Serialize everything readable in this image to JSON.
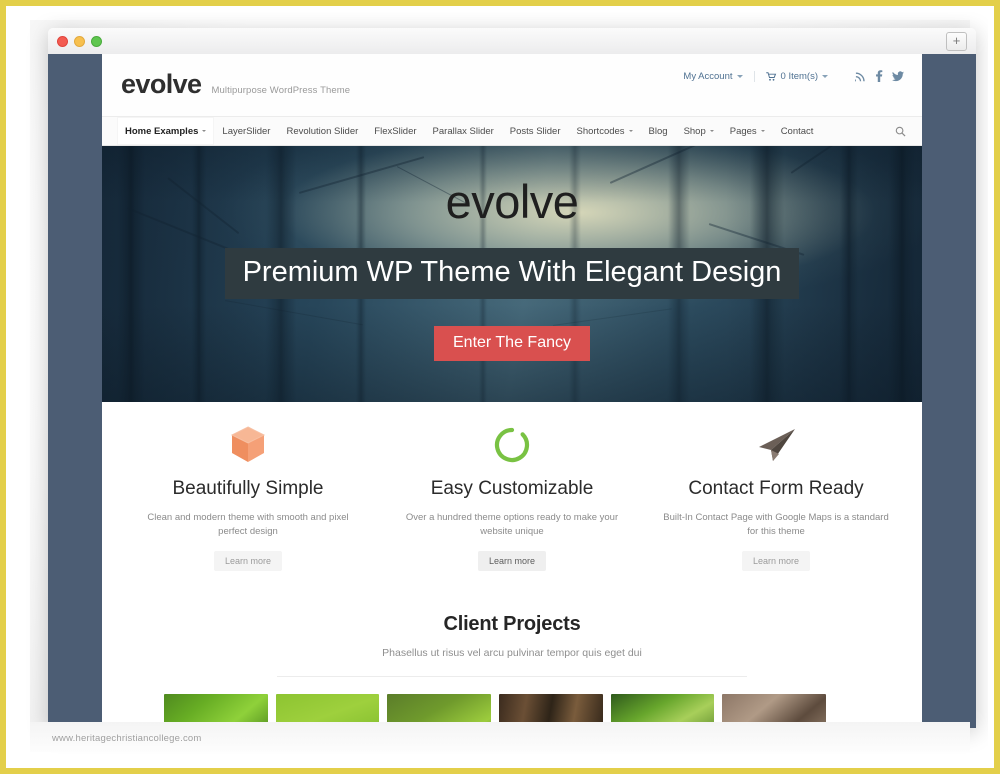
{
  "browser": {
    "traffic_lights": [
      "close",
      "minimize",
      "zoom"
    ],
    "new_tab_label": "+"
  },
  "site": {
    "logo": "evolve",
    "tagline": "Multipurpose WordPress Theme",
    "topbar": {
      "account_label": "My Account",
      "cart_label": "0 Item(s)",
      "social": [
        "rss-icon",
        "facebook-icon",
        "twitter-icon"
      ]
    },
    "nav": [
      {
        "label": "Home Examples",
        "caret": true,
        "active": true
      },
      {
        "label": "LayerSlider",
        "caret": false,
        "active": false
      },
      {
        "label": "Revolution Slider",
        "caret": false,
        "active": false
      },
      {
        "label": "FlexSlider",
        "caret": false,
        "active": false
      },
      {
        "label": "Parallax Slider",
        "caret": false,
        "active": false
      },
      {
        "label": "Posts Slider",
        "caret": false,
        "active": false
      },
      {
        "label": "Shortcodes",
        "caret": true,
        "active": false
      },
      {
        "label": "Blog",
        "caret": false,
        "active": false
      },
      {
        "label": "Shop",
        "caret": true,
        "active": false
      },
      {
        "label": "Pages",
        "caret": true,
        "active": false
      },
      {
        "label": "Contact",
        "caret": false,
        "active": false
      }
    ],
    "hero": {
      "title": "evolve",
      "band": "Premium WP Theme With Elegant Design",
      "cta": "Enter The Fancy",
      "cta_color": "#d9504f",
      "band_color": "#2f3b40"
    },
    "features": [
      {
        "icon": "cube-icon",
        "icon_color": "#f0936a",
        "title": "Beautifully Simple",
        "desc": "Clean and modern theme with smooth and pixel perfect design",
        "button": "Learn more"
      },
      {
        "icon": "circle-ring-icon",
        "icon_color": "#7cc24a",
        "title": "Easy Customizable",
        "desc": "Over a hundred theme options ready to make your website unique",
        "button": "Learn more"
      },
      {
        "icon": "paper-plane-icon",
        "icon_color": "#5d534d",
        "title": "Contact Form Ready",
        "desc": "Built-In Contact Page with Google Maps is a standard for this theme",
        "button": "Learn more"
      }
    ],
    "projects": {
      "title": "Client Projects",
      "subtitle": "Phasellus ut risus vel arcu pulvinar tempor quis eget dui",
      "thumbnails": [
        "green-leaves-photo",
        "green-gradient-photo",
        "green-frog-photo",
        "bamboo-photo",
        "jungle-path-photo",
        "animal-fur-photo"
      ]
    }
  },
  "watermark": "www.heritagechristiancollege.com",
  "colors": {
    "frame": "#e3cf4a",
    "page_bg": "#4c5d74",
    "accent_red": "#d9504f",
    "link_blue": "#4f7191"
  }
}
